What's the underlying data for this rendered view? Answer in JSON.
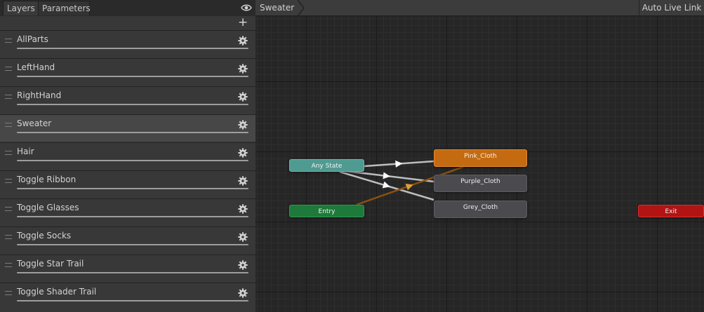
{
  "tabs": [
    "Layers",
    "Parameters"
  ],
  "layers": [
    {
      "name": "AllParts",
      "selected": false
    },
    {
      "name": "LeftHand",
      "selected": false
    },
    {
      "name": "RightHand",
      "selected": false
    },
    {
      "name": "Sweater",
      "selected": true
    },
    {
      "name": "Hair",
      "selected": false
    },
    {
      "name": "Toggle Ribbon",
      "selected": false
    },
    {
      "name": "Toggle Glasses",
      "selected": false
    },
    {
      "name": "Toggle Socks",
      "selected": false
    },
    {
      "name": "Toggle Star Trail",
      "selected": false
    },
    {
      "name": "Toggle Shader Trail",
      "selected": false
    }
  ],
  "breadcrumb": "Sweater",
  "auto_live_link": "Auto Live Link",
  "states": {
    "any_state": "Any State",
    "entry": "Entry",
    "exit": "Exit",
    "pink": "Pink_Cloth",
    "purple": "Purple_Cloth",
    "grey": "Grey_Cloth"
  },
  "colors": {
    "any_state": "#4f9a91",
    "entry": "#1d7a3a",
    "exit": "#b21414",
    "default_state": "#c46b12",
    "state": "#4a4a4f",
    "transition": "#bdbdbd",
    "default_transition": "#8a5010"
  },
  "icons": {
    "eye": "eye-icon",
    "add": "plus-icon",
    "settings": "gear-icon"
  }
}
